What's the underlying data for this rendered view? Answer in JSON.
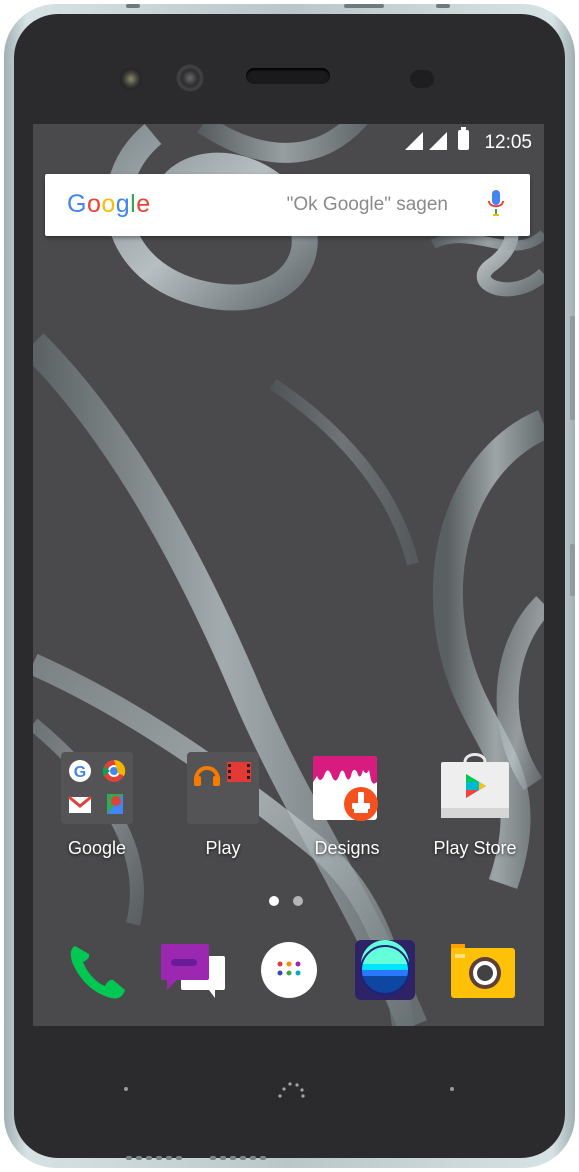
{
  "status_bar": {
    "time": "12:05",
    "icons": [
      "signal-icon",
      "signal-icon",
      "battery-icon"
    ]
  },
  "search": {
    "logo": [
      "G",
      "o",
      "o",
      "g",
      "l",
      "e"
    ],
    "logo_colors": [
      "#4285F4",
      "#EA4335",
      "#FBBC05",
      "#4285F4",
      "#34A853",
      "#EA4335"
    ],
    "hint": "\"Ok Google\" sagen",
    "mic_icon": "mic-icon"
  },
  "home_apps": [
    {
      "label": "Google",
      "icon": "google-folder-icon"
    },
    {
      "label": "Play",
      "icon": "play-folder-icon"
    },
    {
      "label": "Designs",
      "icon": "designs-icon"
    },
    {
      "label": "Play Store",
      "icon": "play-store-icon"
    }
  ],
  "page_indicator": {
    "pages": 2,
    "current": 1
  },
  "dock": [
    {
      "name": "phone-icon"
    },
    {
      "name": "messaging-icon"
    },
    {
      "name": "app-drawer-icon"
    },
    {
      "name": "browser-icon"
    },
    {
      "name": "camera-icon"
    }
  ],
  "colors": {
    "screen_bg": "#4b4b4d",
    "phone_body": "#2b2b2d",
    "frame": "#b9c7ca",
    "label_text": "#ffffff"
  }
}
